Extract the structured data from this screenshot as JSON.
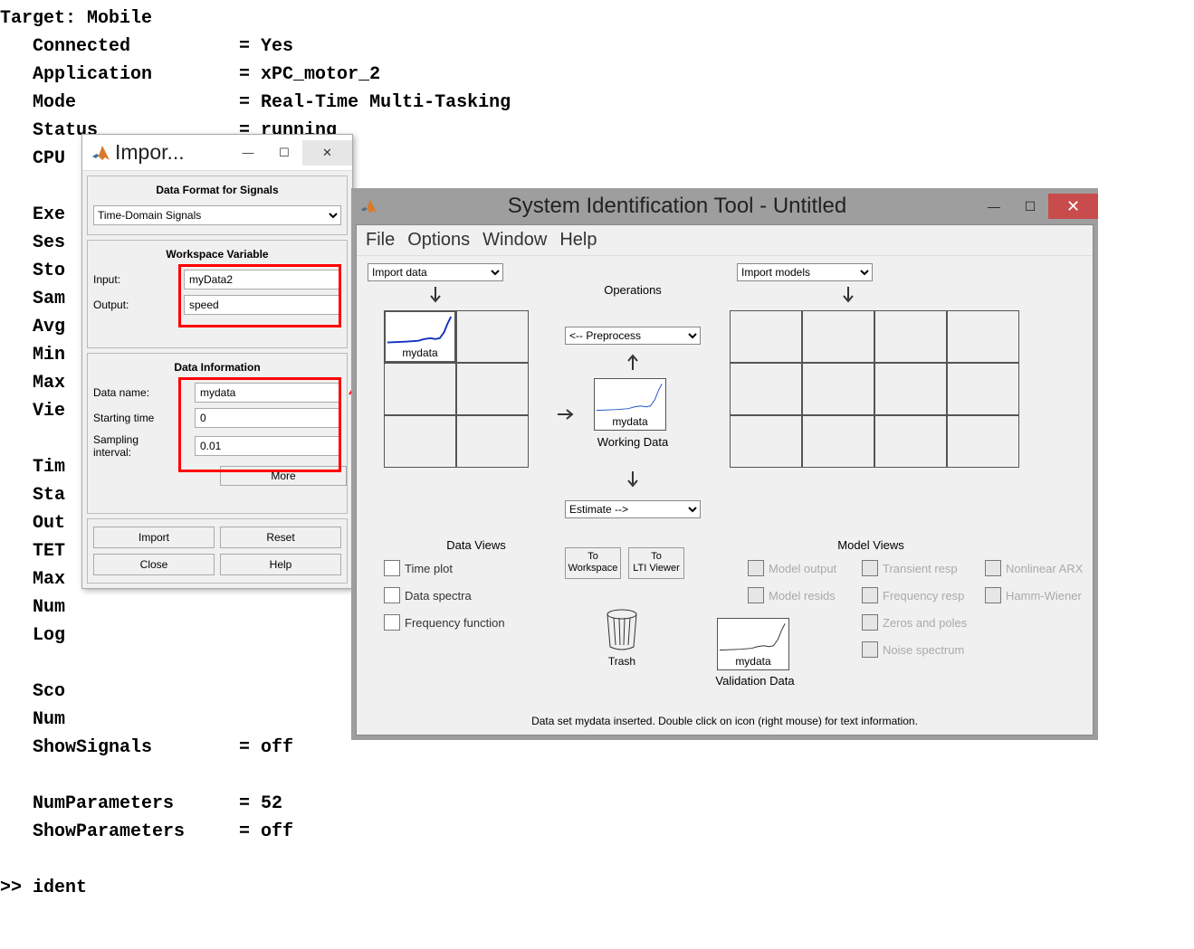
{
  "console": {
    "lines": [
      "Target: Mobile",
      "   Connected          = Yes",
      "   Application        = xPC_motor_2",
      "   Mode               = Real-Time Multi-Tasking",
      "   Status             = running",
      "   CPU",
      "",
      "   Exe",
      "   Ses",
      "   Sto",
      "   Sam",
      "   Avg",
      "   Min",
      "   Max",
      "   Vie",
      "",
      "   Tim",
      "   Sta",
      "   Out",
      "   TET",
      "   Max",
      "   Num",
      "   Log",
      "",
      "   Sco",
      "   Num",
      "   ShowSignals        = off",
      "",
      "   NumParameters      = 52",
      "   ShowParameters     = off",
      "",
      ">> ident"
    ]
  },
  "import_dialog": {
    "title": "Impor...",
    "section1": {
      "title": "Data Format for Signals",
      "format_value": "Time-Domain Signals"
    },
    "section2": {
      "title": "Workspace Variable",
      "input_label": "Input:",
      "input_value": "myData2",
      "output_label": "Output:",
      "output_value": "speed"
    },
    "section3": {
      "title": "Data Information",
      "name_label": "Data name:",
      "name_value": "mydata",
      "start_label": "Starting time",
      "start_value": "0",
      "interval_label": "Sampling interval:",
      "interval_value": "0.01",
      "more": "More"
    },
    "buttons": {
      "import": "Import",
      "reset": "Reset",
      "close": "Close",
      "help": "Help"
    }
  },
  "sit": {
    "title": "System Identification Tool - Untitled",
    "menu": {
      "file": "File",
      "options": "Options",
      "window": "Window",
      "help": "Help"
    },
    "import_data_sel": "Import data",
    "import_models_sel": "Import models",
    "operations_label": "Operations",
    "preprocess_sel": "<-- Preprocess",
    "working_data_label": "Working Data",
    "estimate_sel": "Estimate -->",
    "data_views_label": "Data Views",
    "model_views_label": "Model Views",
    "checks": {
      "time_plot": "Time plot",
      "data_spectra": "Data spectra",
      "freq_func": "Frequency function",
      "model_output": "Model output",
      "model_resids": "Model resids",
      "transient": "Transient resp",
      "freq_resp": "Frequency resp",
      "zeros": "Zeros and poles",
      "noise": "Noise spectrum",
      "nonlinear": "Nonlinear ARX",
      "hamm": "Hamm-Wiener"
    },
    "btn_to_workspace": "To\nWorkspace",
    "btn_to_lti": "To\nLTI Viewer",
    "trash_label": "Trash",
    "validation_label": "Validation Data",
    "mydata_label": "mydata",
    "status": "Data set mydata inserted.  Double click on icon (right mouse) for text information."
  }
}
